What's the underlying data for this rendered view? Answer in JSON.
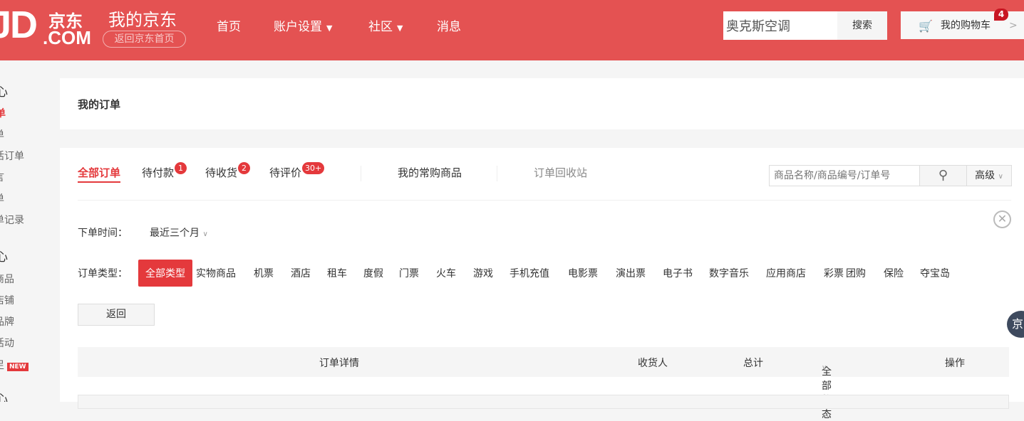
{
  "header": {
    "logo": "JD",
    "logo_cn": "京东",
    "logo_com": ".COM",
    "title": "我的京东",
    "back_home": "返回京东首页",
    "nav": [
      {
        "label": "首页"
      },
      {
        "label": "账户设置",
        "dropdown": true
      },
      {
        "label": "社区",
        "dropdown": true
      },
      {
        "label": "消息"
      }
    ],
    "search_value": "奥克斯空调",
    "search_button": "搜索",
    "cart_label": "我的购物车",
    "cart_count": "4",
    "accent": "#e45252"
  },
  "sidebar": {
    "items": [
      {
        "label": "心",
        "heading": true
      },
      {
        "label": "单",
        "active": true
      },
      {
        "label": "单"
      },
      {
        "label": "活订单"
      },
      {
        "label": "言"
      },
      {
        "label": "单"
      },
      {
        "label": "单记录"
      },
      {
        "label": "心",
        "heading": true
      },
      {
        "label": "商品"
      },
      {
        "label": "店铺"
      },
      {
        "label": "品牌"
      },
      {
        "label": "活动"
      },
      {
        "label": "足",
        "badge": "NEW"
      },
      {
        "label": "心",
        "heading": true
      }
    ]
  },
  "page_title": "我的订单",
  "tabs": [
    {
      "label": "全部订单",
      "active": true
    },
    {
      "label": "待付款",
      "badge": "1"
    },
    {
      "label": "待收货",
      "badge": "2"
    },
    {
      "label": "待评价",
      "badge": "30+"
    },
    {
      "label": "我的常购商品"
    },
    {
      "label": "订单回收站"
    }
  ],
  "order_search": {
    "placeholder": "商品名称/商品编号/订单号",
    "advanced": "高级"
  },
  "filters": {
    "time_label": "下单时间：",
    "time_value": "最近三个月",
    "type_label": "订单类型：",
    "types": [
      "全部类型",
      "实物商品",
      "机票",
      "酒店",
      "租车",
      "度假",
      "门票",
      "火车",
      "游戏",
      "手机充值",
      "电影票",
      "演出票",
      "电子书",
      "数字音乐",
      "应用商店",
      "彩票",
      "团购",
      "保险",
      "夺宝岛"
    ],
    "back_button": "返回"
  },
  "table": {
    "headers": [
      "订单详情",
      "收货人",
      "总计",
      "全部状态",
      "操作"
    ]
  },
  "float_widget": "京"
}
